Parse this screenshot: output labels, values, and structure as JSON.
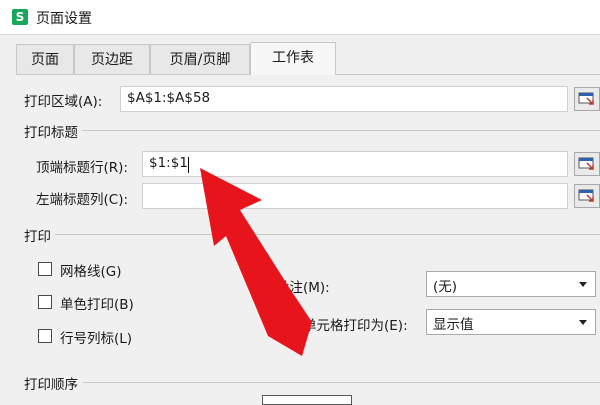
{
  "window": {
    "title": "页面设置",
    "app_icon": "S"
  },
  "tabs": [
    {
      "label": "页面"
    },
    {
      "label": "页边距"
    },
    {
      "label": "页眉/页脚"
    },
    {
      "label": "工作表"
    }
  ],
  "print_area": {
    "label": "打印区域(A):",
    "value": "$A$1:$A$58"
  },
  "print_titles": {
    "section": "打印标题",
    "top_rows": {
      "label": "顶端标题行(R):",
      "value": "$1:$1"
    },
    "left_columns": {
      "label": "左端标题列(C):",
      "value": ""
    }
  },
  "print": {
    "section": "打印",
    "gridlines": {
      "label": "网格线(G)",
      "checked": false
    },
    "black_white": {
      "label": "单色打印(B)",
      "checked": false
    },
    "row_col_headings": {
      "label": "行号列标(L)",
      "checked": false
    },
    "comments": {
      "label": "批注(M):",
      "value": "(无)"
    },
    "cell_errors": {
      "label": "错误单元格打印为(E):",
      "value": "显示值"
    }
  },
  "print_order": {
    "section": "打印顺序"
  },
  "colors": {
    "annotation_arrow": "#e8141b",
    "app_icon": "#1aa75c"
  },
  "icons": {
    "range_button": "range-select-icon",
    "dropdown": "chevron-down-icon"
  }
}
